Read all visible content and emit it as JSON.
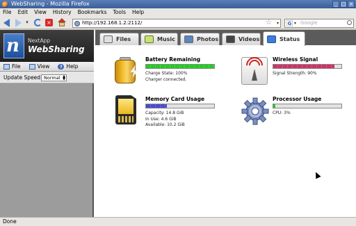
{
  "window": {
    "title": "WebSharing - Mozilla Firefox"
  },
  "menu": {
    "items": [
      "File",
      "Edit",
      "View",
      "History",
      "Bookmarks",
      "Tools",
      "Help"
    ]
  },
  "nav": {
    "url": "http://192.168.1.2:2112/",
    "search_placeholder": "Google",
    "search_engine_glyph": "G"
  },
  "logo": {
    "small": "NextApp",
    "big": "WebSharing",
    "glyph": "n"
  },
  "sidebar": {
    "menu": {
      "file": "File",
      "view": "View",
      "help": "Help"
    },
    "speed_label": "Update Speed:",
    "speed_value": "Normal"
  },
  "tabs": {
    "files": "Files",
    "music": "Music",
    "photos": "Photos",
    "videos": "Videos",
    "status": "Status",
    "active": "Status"
  },
  "status": {
    "battery": {
      "title": "Battery Remaining",
      "level": 1.0,
      "color": "#22cc22",
      "line1": "Charge State: 100%",
      "line2": "Charger connected."
    },
    "wireless": {
      "title": "Wireless Signal",
      "level": 0.9,
      "color": "#cc3366",
      "line1": "Signal Strength: 90%"
    },
    "memory": {
      "title": "Memory Card Usage",
      "level": 0.31,
      "color": "#4a4ad0",
      "line1": "Capacity: 14.8 GiB",
      "line2": "In Use: 4.6 GiB",
      "line3": "Available: 10.2 GiB"
    },
    "processor": {
      "title": "Processor Usage",
      "level": 0.03,
      "color": "#22cc22",
      "line1": "CPU: 3%"
    }
  },
  "statusbar": {
    "text": "Done"
  }
}
